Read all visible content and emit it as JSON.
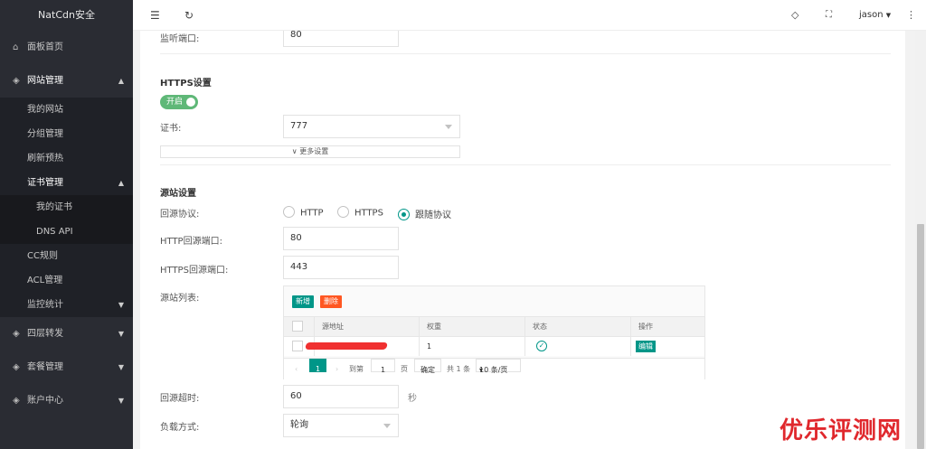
{
  "sidebar": {
    "logo": "NatCdn安全",
    "dashboard": "面板首页",
    "site_mgmt": "网站管理",
    "my_sites": "我的网站",
    "group_mgmt": "分组管理",
    "refresh": "刷新预热",
    "cert_mgmt": "证书管理",
    "my_certs": "我的证书",
    "dns_api": "DNS API",
    "cc_rules": "CC规则",
    "acl": "ACL管理",
    "monitor": "监控统计",
    "l4": "四层转发",
    "plans": "套餐管理",
    "account": "账户中心"
  },
  "header": {
    "user": "jason"
  },
  "form": {
    "listen_port_label": "监听端口:",
    "listen_port_value": "80",
    "https_title": "HTTPS设置",
    "switch_label": "开启",
    "cert_label": "证书:",
    "cert_value": "777",
    "more_settings": "更多设置",
    "origin_title": "源站设置",
    "protocol_label": "回源协议:",
    "protocol_http": "HTTP",
    "protocol_https": "HTTPS",
    "protocol_follow": "跟随协议",
    "http_port_label": "HTTP回源端口:",
    "http_port_value": "80",
    "https_port_label": "HTTPS回源端口:",
    "https_port_value": "443",
    "origin_list_label": "源站列表:",
    "add_btn": "新增",
    "del_btn": "删除",
    "col_addr": "源地址",
    "col_weight": "权重",
    "col_status": "状态",
    "col_action": "操作",
    "row_weight": "1",
    "row_edit": "编辑",
    "pager_page": "1",
    "pager_goto": "到第",
    "pager_input": "1",
    "pager_page_unit": "页",
    "pager_confirm": "确定",
    "pager_total": "共 1 条",
    "pager_size": "10 条/页",
    "timeout_label": "回源超时:",
    "timeout_value": "60",
    "timeout_unit": "秒",
    "lb_label": "负载方式:",
    "lb_value": "轮询"
  },
  "watermark": "优乐评测网",
  "colors": {
    "sidebar_bg": "#2a2c33",
    "accent": "#009688",
    "switch": "#5fb878",
    "danger": "#ff5722"
  }
}
